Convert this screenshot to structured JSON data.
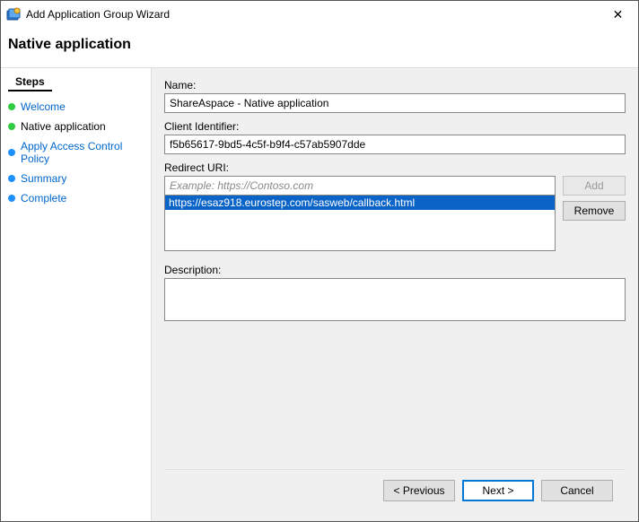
{
  "window": {
    "title": "Add Application Group Wizard",
    "heading": "Native application",
    "close_glyph": "✕"
  },
  "steps": {
    "heading": "Steps",
    "items": [
      {
        "label": "Welcome",
        "dot": "green",
        "link": "blue"
      },
      {
        "label": "Native application",
        "dot": "green",
        "link": "black"
      },
      {
        "label": "Apply Access Control Policy",
        "dot": "blue",
        "link": "blue"
      },
      {
        "label": "Summary",
        "dot": "blue",
        "link": "blue"
      },
      {
        "label": "Complete",
        "dot": "blue",
        "link": "blue"
      }
    ]
  },
  "form": {
    "name_label": "Name:",
    "name_value": "ShareAspace - Native application",
    "client_id_label": "Client Identifier:",
    "client_id_value": "f5b65617-9bd5-4c5f-b9f4-c57ab5907dde",
    "redirect_label": "Redirect URI:",
    "redirect_placeholder": "Example: https://Contoso.com",
    "redirect_items": [
      {
        "value": "https://esaz918.eurostep.com/sasweb/callback.html",
        "selected": true
      }
    ],
    "add_label": "Add",
    "remove_label": "Remove",
    "description_label": "Description:",
    "description_value": ""
  },
  "footer": {
    "previous": "< Previous",
    "next": "Next >",
    "cancel": "Cancel"
  }
}
